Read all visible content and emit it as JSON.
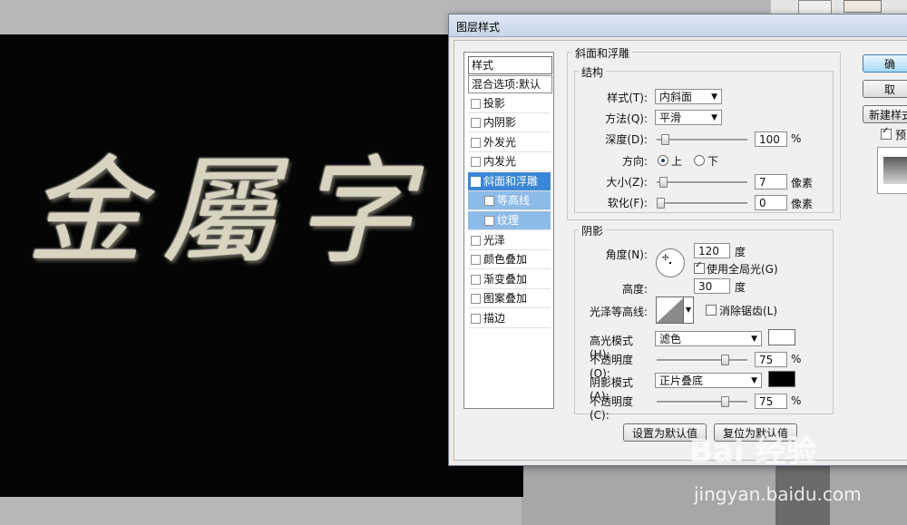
{
  "canvas_text": "金屬字",
  "dialog": {
    "title": "图层样式",
    "styles_header": "样式",
    "blend_options": "混合选项:默认",
    "items": [
      {
        "label": "投影",
        "checked": false
      },
      {
        "label": "内阴影",
        "checked": false
      },
      {
        "label": "外发光",
        "checked": false
      },
      {
        "label": "内发光",
        "checked": false
      },
      {
        "label": "斜面和浮雕",
        "checked": true
      },
      {
        "label": "等高线",
        "checked": false
      },
      {
        "label": "纹理",
        "checked": false
      },
      {
        "label": "光泽",
        "checked": false
      },
      {
        "label": "颜色叠加",
        "checked": false
      },
      {
        "label": "渐变叠加",
        "checked": false
      },
      {
        "label": "图案叠加",
        "checked": false
      },
      {
        "label": "描边",
        "checked": false
      }
    ],
    "bevel": {
      "group_title": "斜面和浮雕",
      "structure_title": "结构",
      "style_label": "样式(T):",
      "style_value": "内斜面",
      "technique_label": "方法(Q):",
      "technique_value": "平滑",
      "depth_label": "深度(D):",
      "depth_value": "100",
      "depth_unit": "%",
      "depth_level": 0.05,
      "direction_label": "方向:",
      "direction_up": "上",
      "direction_down": "下",
      "size_label": "大小(Z):",
      "size_value": "7",
      "size_unit": "像素",
      "soften_label": "软化(F):",
      "soften_value": "0",
      "soften_unit": "像素"
    },
    "shading": {
      "group_title": "阴影",
      "angle_label": "角度(N):",
      "angle_value": "120",
      "angle_unit": "度",
      "global_light": "使用全局光(G)",
      "altitude_label": "高度:",
      "altitude_value": "30",
      "altitude_unit": "度",
      "gloss_label": "光泽等高线:",
      "anti_aliased": "消除锯齿(L)",
      "highlight_mode_label": "高光模式(H):",
      "highlight_mode_value": "滤色",
      "highlight_color": "#ffffff",
      "highlight_opacity_label": "不透明度(O):",
      "highlight_opacity_value": "75",
      "shadow_mode_label": "阴影模式(A):",
      "shadow_mode_value": "正片叠底",
      "shadow_color": "#000000",
      "shadow_opacity_label": "不透明度(C):",
      "shadow_opacity_value": "75",
      "percent": "%"
    },
    "buttons": {
      "set_default": "设置为默认值",
      "reset_default": "复位为默认值",
      "ok": "确",
      "cancel": "取",
      "new_style": "新建样式",
      "preview": "预"
    }
  },
  "watermark": {
    "main": "Bai 经验",
    "sub": "jingyan.baidu.com"
  }
}
